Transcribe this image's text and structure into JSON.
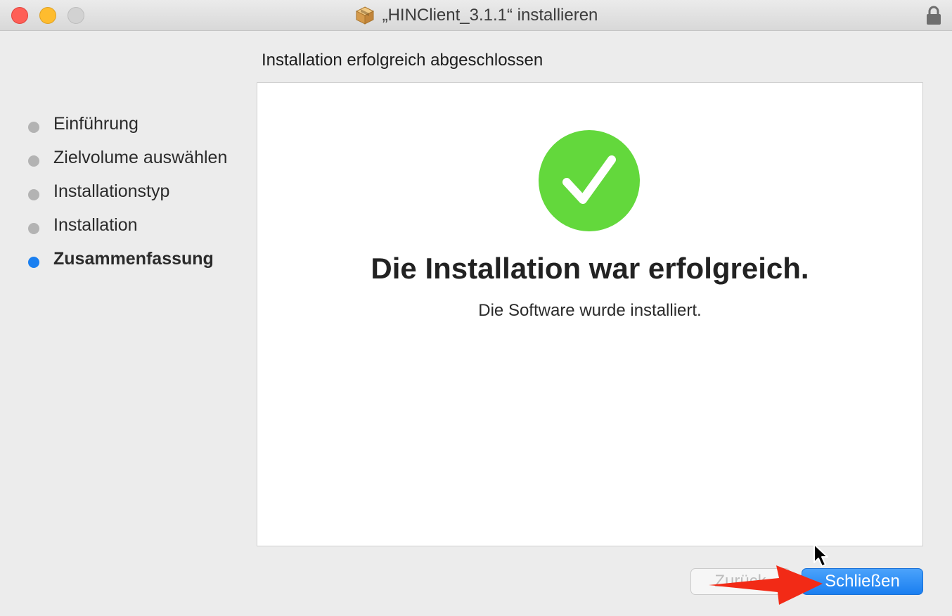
{
  "window": {
    "title": "„HINClient_3.1.1“ installieren"
  },
  "sidebar": {
    "steps": [
      {
        "label": "Einführung"
      },
      {
        "label": "Zielvolume auswählen"
      },
      {
        "label": "Installationstyp"
      },
      {
        "label": "Installation"
      },
      {
        "label": "Zusammenfassung",
        "active": true
      }
    ]
  },
  "main": {
    "heading": "Installation erfolgreich abgeschlossen",
    "headline": "Die Installation war erfolgreich.",
    "subtext": "Die Software wurde installiert."
  },
  "footer": {
    "back_label": "Zurück",
    "close_label": "Schließen"
  },
  "icons": {
    "package": "package-icon",
    "lock": "lock-icon",
    "success": "checkmark-circle-icon",
    "annotation": "red-arrow-icon",
    "cursor": "mouse-pointer-icon"
  },
  "colors": {
    "accent": "#1a7ff0",
    "success": "#63d83c",
    "arrow": "#f22a16",
    "traffic_close": "#fe5f57",
    "traffic_minimize": "#febc2e",
    "traffic_zoom_disabled": "#d2d2d2"
  }
}
